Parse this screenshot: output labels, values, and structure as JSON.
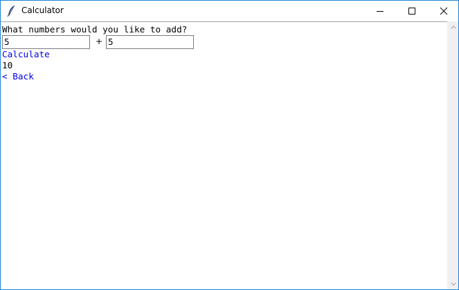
{
  "window": {
    "title": "Calculator",
    "icon": "feather-icon",
    "controls": {
      "minimize": "minimize-icon",
      "maximize": "maximize-icon",
      "close": "close-icon"
    }
  },
  "form": {
    "question": "What numbers would you like to add?",
    "first_value": "5",
    "operator": "+",
    "second_value": "5",
    "calculate_label": "Calculate",
    "result": "10",
    "back_label": "< Back"
  },
  "colors": {
    "link": "#0000ee",
    "window_border": "#1883d7",
    "scrollbar": "#f0f0f0"
  }
}
